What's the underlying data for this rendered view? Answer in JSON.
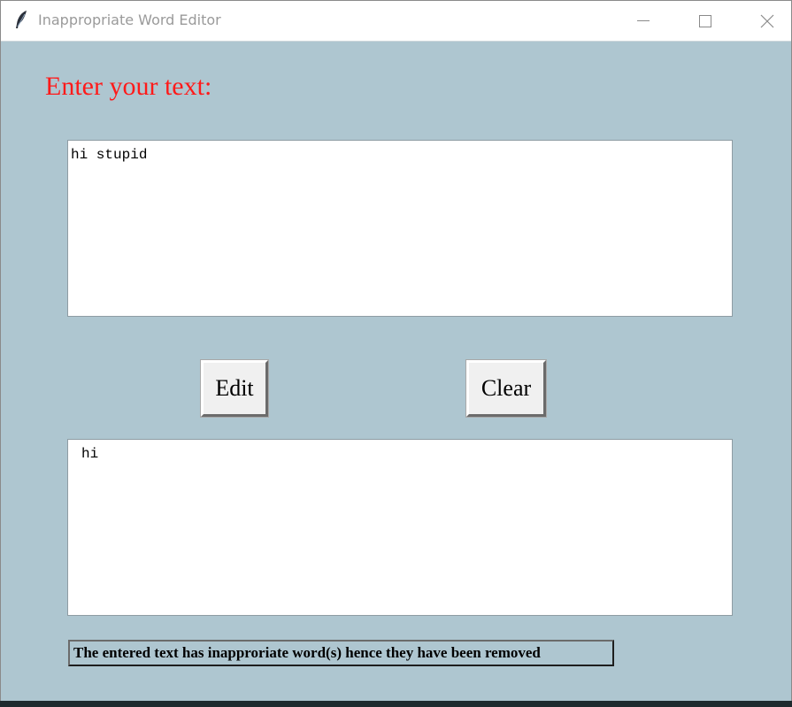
{
  "window": {
    "title": "Inappropriate Word Editor",
    "icon": "feather-icon",
    "controls": [
      "minimize-icon",
      "maximize-icon",
      "close-icon"
    ]
  },
  "main": {
    "prompt_label": "Enter your text:",
    "input_text": "hi stupid",
    "edit_label": "Edit",
    "clear_label": "Clear",
    "output_text": "hi",
    "status_message": "The entered text has inapproriate word(s) hence they have been removed"
  },
  "colors": {
    "window_bg": "#aec6d0",
    "prompt_color": "#ff1a1a",
    "titlebar_bg": "#ffffff"
  }
}
